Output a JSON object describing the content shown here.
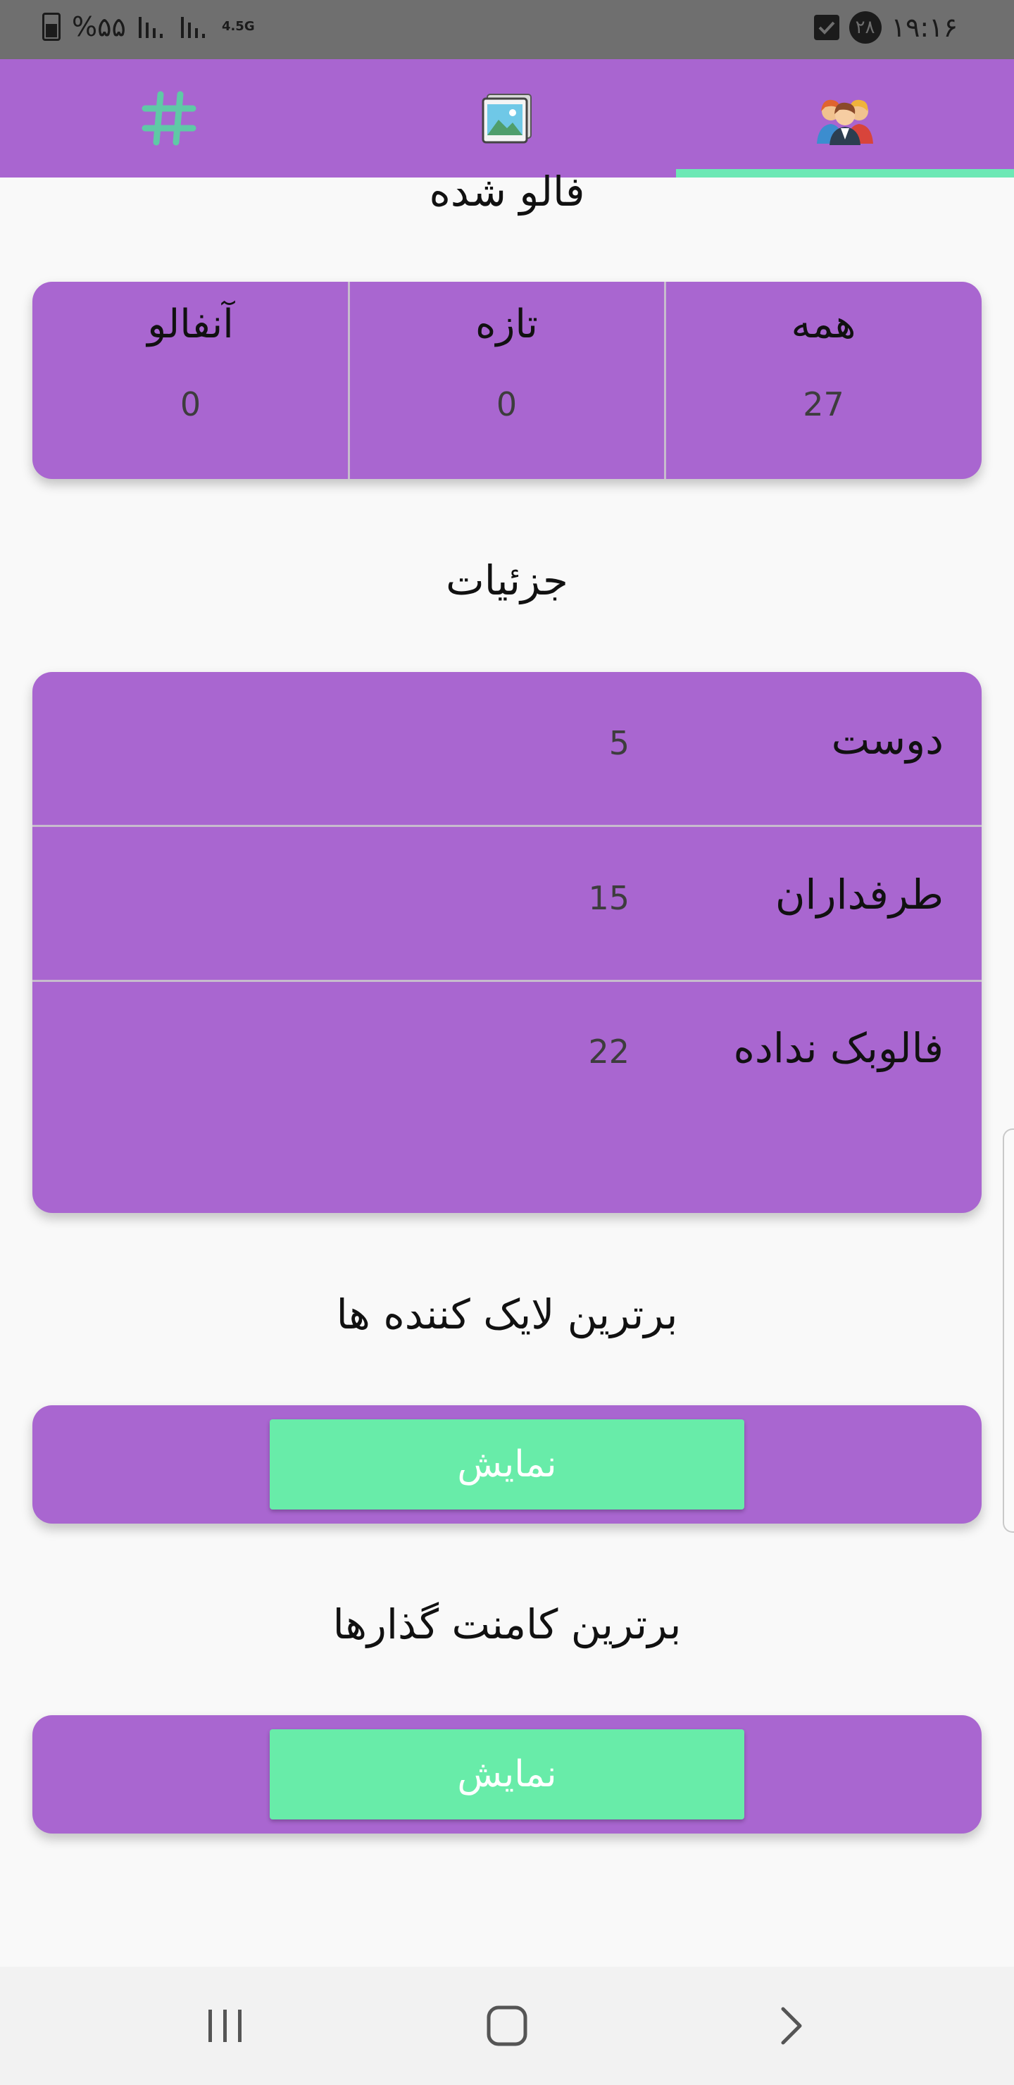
{
  "status_bar": {
    "time": "۱۹:۱۶",
    "date_badge": "۲۸",
    "battery_percent": "%۵۵",
    "network": "4.5G"
  },
  "tabs": [
    {
      "icon": "hashtag-icon"
    },
    {
      "icon": "gallery-icon"
    },
    {
      "icon": "people-icon",
      "selected": true
    }
  ],
  "sections": {
    "followed_title": "فالو شده",
    "details_title": "جزئیات",
    "top_likers_title": "برترین لایک کننده ها",
    "top_commenters_title": "برترین کامنت گذارها"
  },
  "followed_stats": [
    {
      "label": "همه",
      "value": "27"
    },
    {
      "label": "تازه",
      "value": "0"
    },
    {
      "label": "آنفالو",
      "value": "0"
    }
  ],
  "details": [
    {
      "label": "دوست",
      "value": "5"
    },
    {
      "label": "طرفداران",
      "value": "15"
    },
    {
      "label": "فالوبک نداده",
      "value": "22"
    }
  ],
  "buttons": {
    "show_likers": "نمایش",
    "show_commenters": "نمایش"
  },
  "colors": {
    "primary": "#a966d0",
    "accent": "#68eca9",
    "status_bar": "#6f6f6f"
  }
}
